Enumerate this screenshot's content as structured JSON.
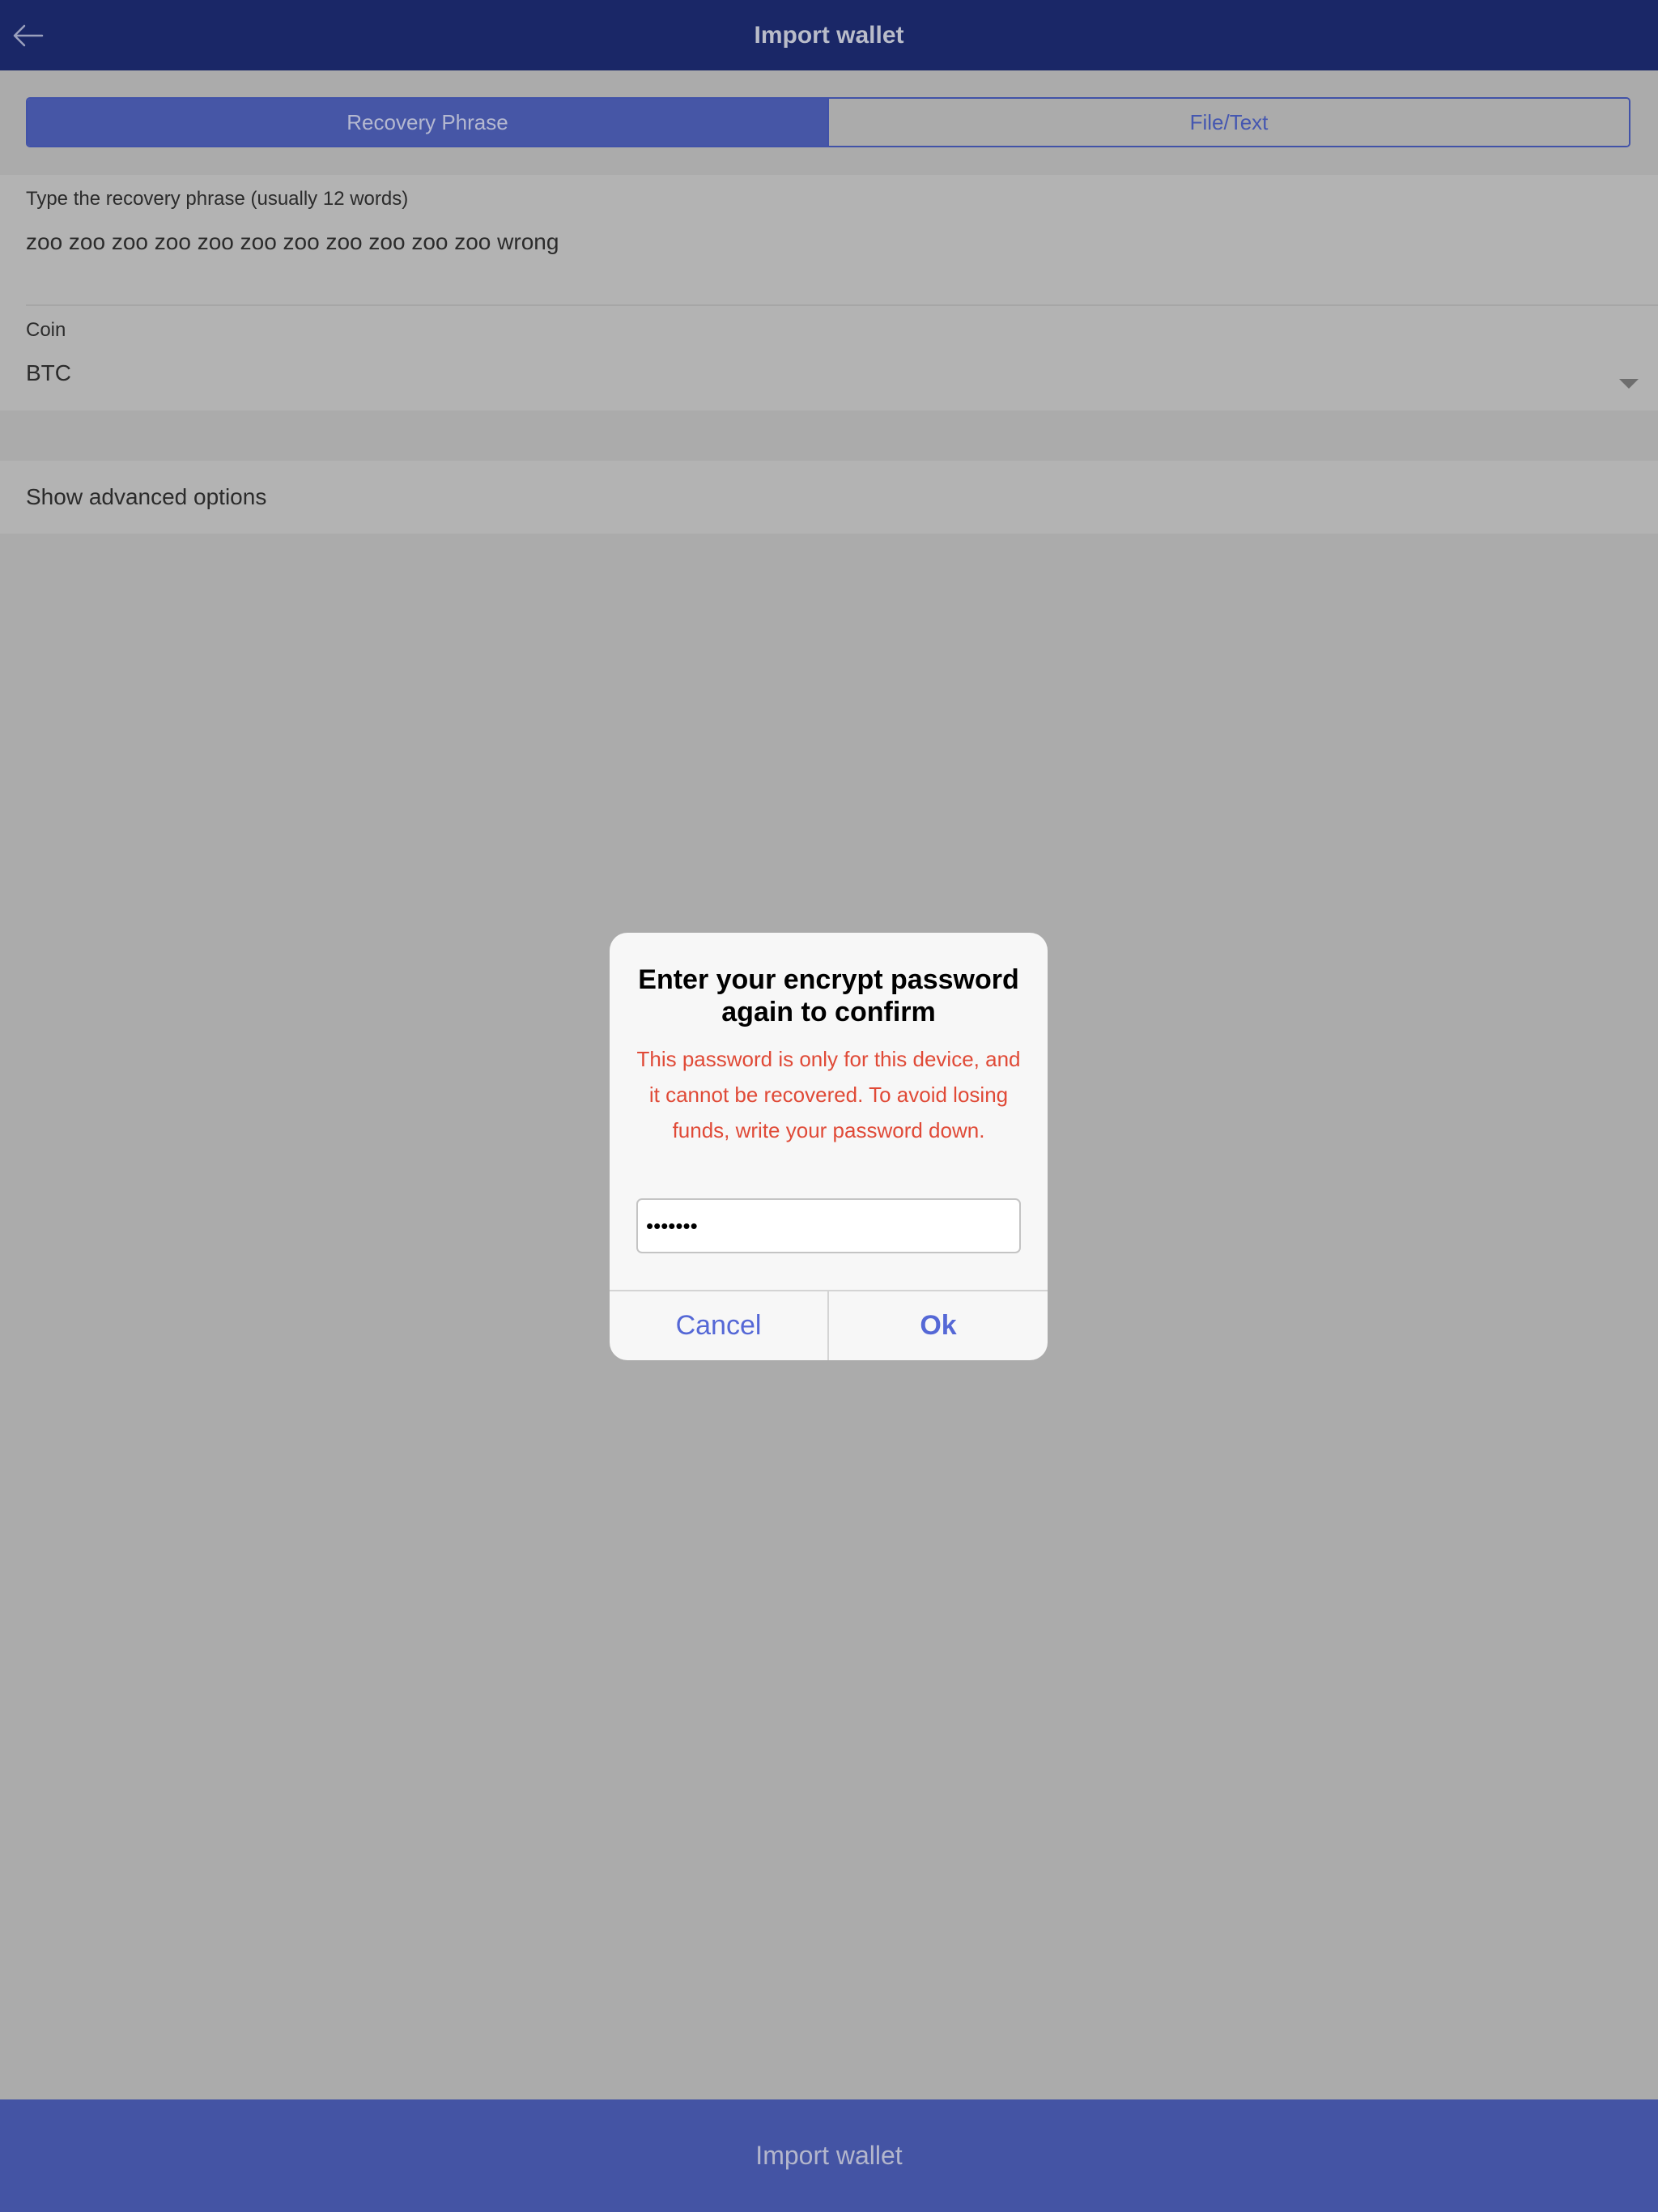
{
  "header": {
    "title": "Import wallet",
    "back_icon": "arrow-left-icon"
  },
  "tabs": [
    {
      "label": "Recovery Phrase",
      "active": true
    },
    {
      "label": "File/Text",
      "active": false
    }
  ],
  "form": {
    "phrase_label": "Type the recovery phrase (usually 12 words)",
    "phrase_value": "zoo zoo zoo zoo zoo zoo zoo zoo zoo zoo zoo wrong",
    "coin_label": "Coin",
    "coin_value": "BTC",
    "advanced_label": "Show advanced options"
  },
  "dialog": {
    "title": "Enter your encrypt password again to confirm",
    "message": "This password is only for this device, and it cannot be recovered. To avoid losing funds, write your password down.",
    "password_value": "•••••••",
    "cancel_label": "Cancel",
    "ok_label": "Ok"
  },
  "bottom": {
    "import_label": "Import wallet"
  },
  "colors": {
    "header_bg": "#1a2767",
    "accent": "#4656a6",
    "warning": "#e04a37",
    "dialog_button": "#5568d6"
  }
}
